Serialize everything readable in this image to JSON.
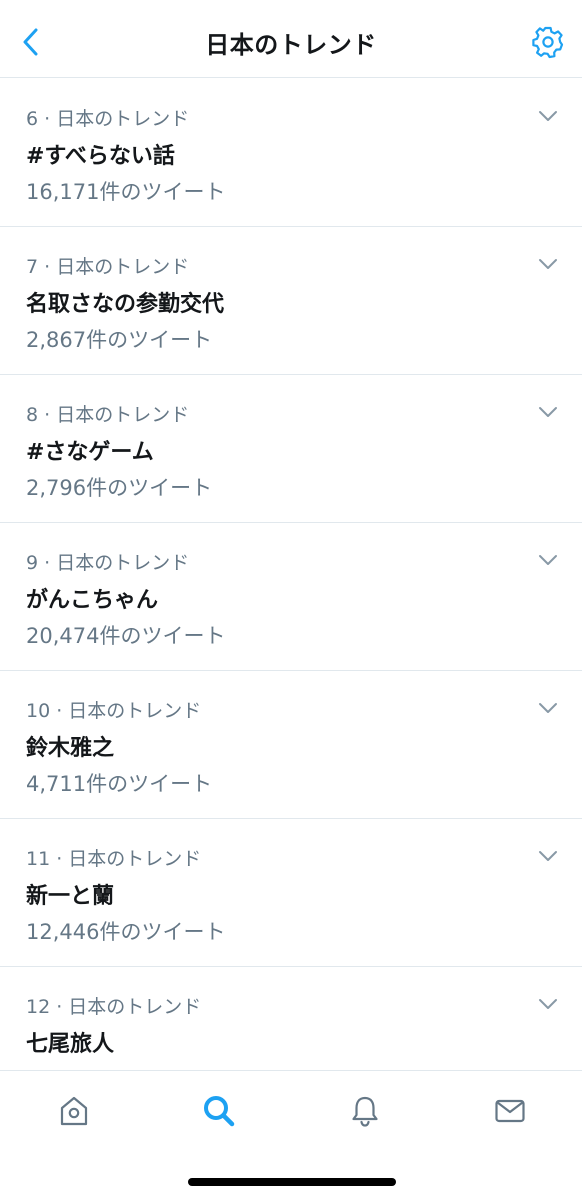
{
  "header": {
    "title": "日本のトレンド"
  },
  "icons": {
    "back": "chevron-left-icon",
    "settings": "gear-icon",
    "expand": "chevron-down-icon"
  },
  "colors": {
    "accent": "#1da1f2",
    "secondary_text": "#657786",
    "divider": "#e1e8ed"
  },
  "trends": [
    {
      "meta": "6 · 日本のトレンド",
      "name": "#すべらない話",
      "count": "16,171件のツイート"
    },
    {
      "meta": "7 · 日本のトレンド",
      "name": "名取さなの参勤交代",
      "count": "2,867件のツイート"
    },
    {
      "meta": "8 · 日本のトレンド",
      "name": "#さなゲーム",
      "count": "2,796件のツイート"
    },
    {
      "meta": "9 · 日本のトレンド",
      "name": "がんこちゃん",
      "count": "20,474件のツイート"
    },
    {
      "meta": "10 · 日本のトレンド",
      "name": "鈴木雅之",
      "count": "4,711件のツイート"
    },
    {
      "meta": "11 · 日本のトレンド",
      "name": "新一と蘭",
      "count": "12,446件のツイート"
    },
    {
      "meta": "12 · 日本のトレンド",
      "name": "七尾旅人",
      "count": ""
    }
  ],
  "tabbar": {
    "tabs": [
      {
        "icon": "home-icon",
        "active": false
      },
      {
        "icon": "search-icon",
        "active": true
      },
      {
        "icon": "notifications-bell-icon",
        "active": false
      },
      {
        "icon": "messages-envelope-icon",
        "active": false
      }
    ]
  }
}
